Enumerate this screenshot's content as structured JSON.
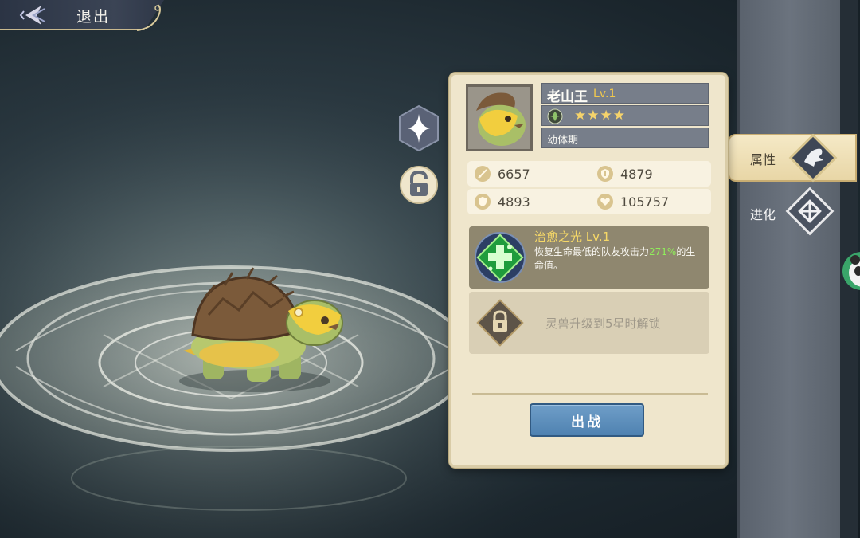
{
  "header": {
    "exit_label": "退出",
    "icons": [
      "back-arrow-icon"
    ]
  },
  "pet": {
    "name": "老山王",
    "level": "Lv.1",
    "element_icon": "leaf-element-icon",
    "stars": "★★★★",
    "star_count": 4,
    "stage": "幼体期"
  },
  "stats": [
    {
      "icon": "sword-icon",
      "value": "6657"
    },
    {
      "icon": "shield-icon",
      "value": "4879"
    },
    {
      "icon": "armor-icon",
      "value": "4893"
    },
    {
      "icon": "heart-icon",
      "value": "105757"
    }
  ],
  "skill": {
    "name": "治愈之光",
    "level": "Lv.1",
    "desc_before": "恢复生命最低的队友攻击力",
    "desc_highlight": "271%",
    "desc_after": "的生命值。"
  },
  "locked_skill": {
    "text": "灵兽升级到5星时解锁"
  },
  "action": {
    "fight_label": "出战"
  },
  "tabs": [
    {
      "label": "属性",
      "icon": "dragon-crest-icon",
      "active": true
    },
    {
      "label": "进化",
      "icon": "knot-crest-icon",
      "active": false
    }
  ],
  "colors": {
    "panel_bg": "#efe6cc",
    "accent_gold": "#f6d867",
    "highlight_green": "#8ff05a",
    "button_blue": "#5a8dbb"
  }
}
